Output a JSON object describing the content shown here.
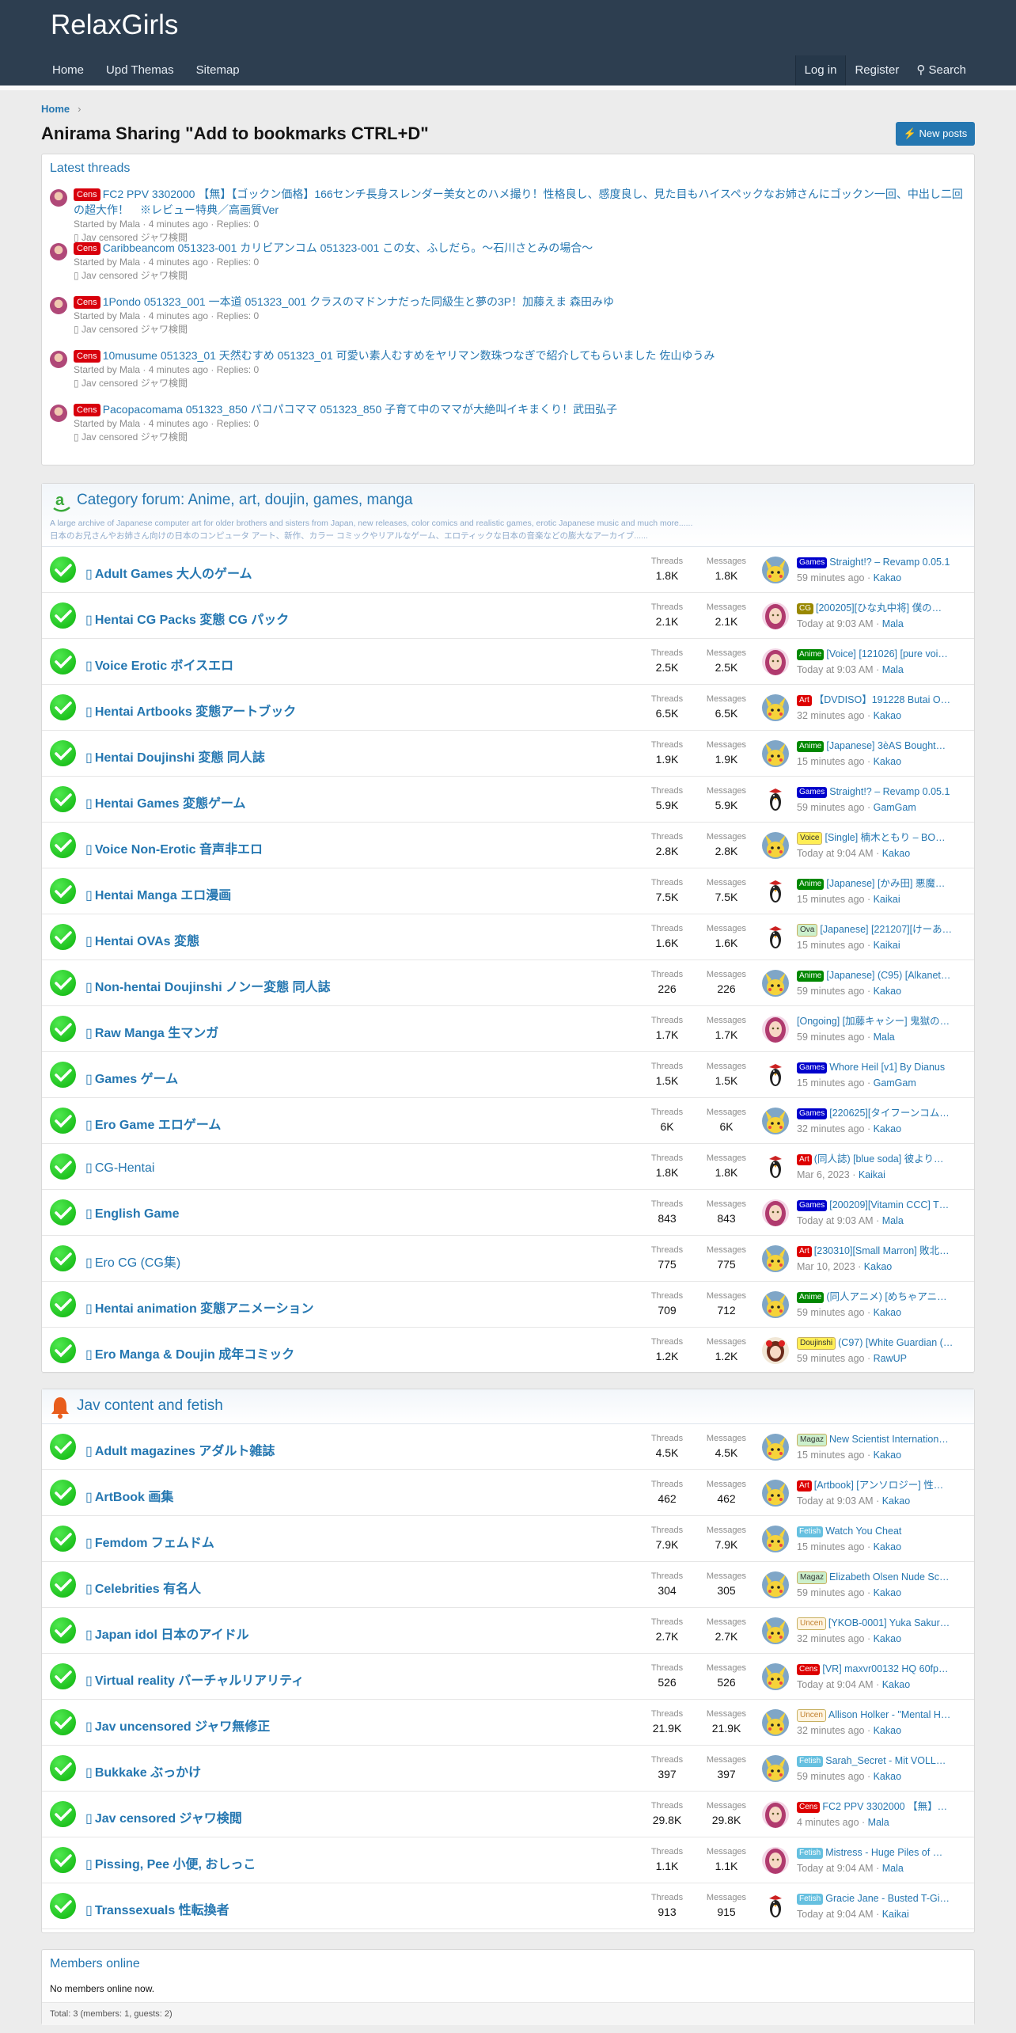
{
  "site": {
    "logo": "RelaxGirls"
  },
  "nav": {
    "left": [
      "Home",
      "Upd Themas",
      "Sitemap"
    ],
    "login": "Log in",
    "register": "Register",
    "search": "Search"
  },
  "breadcrumb": {
    "home": "Home"
  },
  "page": {
    "title": "Anirama Sharing \"Add to bookmarks CTRL+D\"",
    "new_posts": "New posts"
  },
  "latest": {
    "title": "Latest threads",
    "items": [
      {
        "tag": "Cens",
        "title": "FC2 PPV 3302000 【無】【ゴックン価格】166センチ長身スレンダー美女とのハメ撮り！性格良し、感度良し、見た目もハイスペックなお姉さんにゴックン一回、中出し二回の超大作！　※レビュー特典／高画質Ver",
        "meta": "Started by Mala · 4 minutes ago · Replies: 0",
        "forum": "Jav censored ジャワ検閲"
      },
      {
        "tag": "Cens",
        "title": "Caribbeancom 051323-001 カリビアンコム 051323-001 この女、ふしだら。～石川さとみの場合～",
        "meta": "Started by Mala · 4 minutes ago · Replies: 0",
        "forum": "Jav censored ジャワ検閲"
      },
      {
        "tag": "Cens",
        "title": "1Pondo 051323_001 一本道 051323_001 クラスのマドンナだった同級生と夢の3P！加藤えま 森田みゆ",
        "meta": "Started by Mala · 4 minutes ago · Replies: 0",
        "forum": "Jav censored ジャワ検閲"
      },
      {
        "tag": "Cens",
        "title": "10musume 051323_01 天然むすめ 051323_01 可愛い素人むすめをヤリマン数珠つなぎで紹介してもらいました 佐山ゆうみ",
        "meta": "Started by Mala · 4 minutes ago · Replies: 0",
        "forum": "Jav censored ジャワ検閲"
      },
      {
        "tag": "Cens",
        "title": "Pacopacomama 051323_850 パコパコママ 051323_850 子育て中のママが大絶叫イキまくり！武田弘子",
        "meta": "Started by Mala · 4 minutes ago · Replies: 0",
        "forum": "Jav censored ジャワ検閲"
      }
    ]
  },
  "stat_labels": {
    "threads": "Threads",
    "messages": "Messages"
  },
  "cat1": {
    "title": "Category forum: Anime, art, doujin, games, manga",
    "desc1": "A large archive of Japanese computer art for older brothers and sisters from Japan, new releases, color comics and realistic games, erotic Japanese music and much more......",
    "desc2": "日本のお兄さんやお姉さん向けの日本のコンピュータ アート、新作、カラー コミックやリアルなゲーム、エロティックな日本の音楽などの膨大なアーカイブ......",
    "forums": [
      {
        "name": "Adult Games 大人のゲーム",
        "bold": true,
        "threads": "1.8K",
        "messages": "1.8K",
        "av": "pika",
        "tag": "Games",
        "tagc": "#0000cc",
        "tagf": "#fff",
        "last": "Straight!? – Revamp 0.05.1",
        "time": "59 minutes ago",
        "user": "Kakao"
      },
      {
        "name": "Hentai CG Packs 変態 CG パック",
        "bold": true,
        "threads": "2.1K",
        "messages": "2.1K",
        "av": "girl",
        "tag": "CG",
        "tagc": "#998800",
        "tagf": "#fff",
        "last": "[200205][ひな丸中将] 僕の…",
        "time": "Today at 9:03 AM",
        "user": "Mala"
      },
      {
        "name": "Voice Erotic ボイスエロ",
        "bold": true,
        "threads": "2.5K",
        "messages": "2.5K",
        "av": "girl",
        "tag": "Anime",
        "tagc": "#008800",
        "tagf": "#fff",
        "last": "[Voice] [121026] [pure voi…",
        "time": "Today at 9:03 AM",
        "user": "Mala"
      },
      {
        "name": "Hentai Artbooks 変態アートブック",
        "bold": true,
        "threads": "6.5K",
        "messages": "6.5K",
        "av": "pika",
        "tag": "Art",
        "tagc": "#dd0000",
        "tagf": "#fff",
        "last": "【DVDISO】191228 Butai O…",
        "time": "32 minutes ago",
        "user": "Kakao"
      },
      {
        "name": "Hentai Doujinshi 変態 同人誌",
        "bold": true,
        "threads": "1.9K",
        "messages": "1.9K",
        "av": "pika",
        "tag": "Anime",
        "tagc": "#008800",
        "tagf": "#fff",
        "last": "[Japanese] 3èAS Bought…",
        "time": "15 minutes ago",
        "user": "Kakao"
      },
      {
        "name": "Hentai Games 変態ゲーム",
        "bold": true,
        "threads": "5.9K",
        "messages": "5.9K",
        "av": "pen",
        "tag": "Games",
        "tagc": "#0000cc",
        "tagf": "#fff",
        "last": "Straight!? – Revamp 0.05.1",
        "time": "59 minutes ago",
        "user": "GamGam"
      },
      {
        "name": "Voice Non-Erotic 音声非エロ",
        "bold": true,
        "threads": "2.8K",
        "messages": "2.8K",
        "av": "pika",
        "tag": "Voice",
        "tagc": "#ffee55",
        "tagf": "#333",
        "last": "[Single] 楠木ともり – BO…",
        "time": "Today at 9:04 AM",
        "user": "Kakao"
      },
      {
        "name": "Hentai Manga エロ漫画",
        "bold": true,
        "threads": "7.5K",
        "messages": "7.5K",
        "av": "pen",
        "tag": "Anime",
        "tagc": "#008800",
        "tagf": "#fff",
        "last": "[Japanese] [かみ田] 悪魔…",
        "time": "15 minutes ago",
        "user": "Kaikai"
      },
      {
        "name": "Hentai OVAs 変態",
        "bold": true,
        "threads": "1.6K",
        "messages": "1.6K",
        "av": "pen",
        "tag": "Ova",
        "tagc": "#ccf0cc",
        "tagf": "#333",
        "last": "[Japanese] [221207][けーあ…",
        "time": "15 minutes ago",
        "user": "Kaikai"
      },
      {
        "name": "Non-hentai Doujinshi ノンー変態 同人誌",
        "bold": true,
        "threads": "226",
        "messages": "226",
        "av": "pika",
        "tag": "Anime",
        "tagc": "#008800",
        "tagf": "#fff",
        "last": "[Japanese] (C95) [Alkanet…",
        "time": "59 minutes ago",
        "user": "Kakao"
      },
      {
        "name": "Raw Manga 生マンガ",
        "bold": true,
        "threads": "1.7K",
        "messages": "1.7K",
        "av": "girl",
        "tag": "",
        "tagc": "",
        "tagf": "",
        "last": "[Ongoing] [加藤キャシー] 鬼獄の…",
        "time": "59 minutes ago",
        "user": "Mala"
      },
      {
        "name": "Games ゲーム",
        "bold": true,
        "threads": "1.5K",
        "messages": "1.5K",
        "av": "pen",
        "tag": "Games",
        "tagc": "#0000cc",
        "tagf": "#fff",
        "last": "Whore Heil [v1] By Dianus",
        "time": "15 minutes ago",
        "user": "GamGam"
      },
      {
        "name": "Ero Game エロゲーム",
        "bold": true,
        "threads": "6K",
        "messages": "6K",
        "av": "pika",
        "tag": "Games",
        "tagc": "#0000cc",
        "tagf": "#fff",
        "last": "[220625][タイフーンコム…",
        "time": "32 minutes ago",
        "user": "Kakao"
      },
      {
        "name": "CG-Hentai",
        "bold": false,
        "threads": "1.8K",
        "messages": "1.8K",
        "av": "pen",
        "tag": "Art",
        "tagc": "#dd0000",
        "tagf": "#fff",
        "last": "(同人誌) [blue soda] 彼より…",
        "time": "Mar 6, 2023",
        "user": "Kaikai"
      },
      {
        "name": "English Game",
        "bold": true,
        "threads": "843",
        "messages": "843",
        "av": "girl",
        "tag": "Games",
        "tagc": "#0000cc",
        "tagf": "#fff",
        "last": "[200209][Vitamin CCC] T…",
        "time": "Today at 9:03 AM",
        "user": "Mala"
      },
      {
        "name": "Ero CG (CG集)",
        "bold": false,
        "threads": "775",
        "messages": "775",
        "av": "pika",
        "tag": "Art",
        "tagc": "#dd0000",
        "tagf": "#fff",
        "last": "[230310][Small Marron] 敗北…",
        "time": "Mar 10, 2023",
        "user": "Kakao"
      },
      {
        "name": "Hentai animation 変態アニメーション",
        "bold": true,
        "threads": "709",
        "messages": "712",
        "av": "pika",
        "tag": "Anime",
        "tagc": "#008800",
        "tagf": "#fff",
        "last": "(同人アニメ) [めちゃアニ…",
        "time": "59 minutes ago",
        "user": "Kakao"
      },
      {
        "name": "Ero Manga & Doujin 成年コミック",
        "bold": true,
        "threads": "1.2K",
        "messages": "1.2K",
        "av": "cherry",
        "tag": "Doujinshi",
        "tagc": "#ffee55",
        "tagf": "#333",
        "last": "(C97) [White Guardian (…",
        "time": "59 minutes ago",
        "user": "RawUP"
      }
    ]
  },
  "cat2": {
    "title": "Jav content and fetish",
    "forums": [
      {
        "name": "Adult magazines アダルト雑誌",
        "bold": true,
        "threads": "4.5K",
        "messages": "4.5K",
        "av": "pika",
        "tag": "Magaz",
        "tagc": "#ccf0cc",
        "tagf": "#333",
        "last": "New Scientist Internation…",
        "time": "15 minutes ago",
        "user": "Kakao"
      },
      {
        "name": "ArtBook 画集",
        "bold": true,
        "threads": "462",
        "messages": "462",
        "av": "pika",
        "tag": "Art",
        "tagc": "#dd0000",
        "tagf": "#fff",
        "last": "[Artbook] [アンソロジー] 性…",
        "time": "Today at 9:03 AM",
        "user": "Kakao"
      },
      {
        "name": "Femdom フェムドム",
        "bold": true,
        "threads": "7.9K",
        "messages": "7.9K",
        "av": "pika",
        "tag": "Fetish",
        "tagc": "#66c0e0",
        "tagf": "#fff",
        "last": "Watch You Cheat",
        "time": "15 minutes ago",
        "user": "Kakao"
      },
      {
        "name": "Celebrities 有名人",
        "bold": true,
        "threads": "304",
        "messages": "305",
        "av": "pika",
        "tag": "Magaz",
        "tagc": "#ccf0cc",
        "tagf": "#333",
        "last": "Elizabeth Olsen Nude Sc…",
        "time": "59 minutes ago",
        "user": "Kakao"
      },
      {
        "name": "Japan idol 日本のアイドル",
        "bold": true,
        "threads": "2.7K",
        "messages": "2.7K",
        "av": "pika",
        "tag": "Uncen",
        "tagc": "#fff4e0",
        "tagf": "#c08030",
        "last": "[YKOB-0001] Yuka Sakur…",
        "time": "32 minutes ago",
        "user": "Kakao"
      },
      {
        "name": "Virtual reality バーチャルリアリティ",
        "bold": true,
        "threads": "526",
        "messages": "526",
        "av": "pika",
        "tag": "Cens",
        "tagc": "#dd0000",
        "tagf": "#fff",
        "last": "[VR] maxvr00132 HQ 60fp…",
        "time": "Today at 9:04 AM",
        "user": "Kakao"
      },
      {
        "name": "Jav uncensored ジャワ無修正",
        "bold": true,
        "threads": "21.9K",
        "messages": "21.9K",
        "av": "pika",
        "tag": "Uncen",
        "tagc": "#fff4e0",
        "tagf": "#c08030",
        "last": "Allison Holker - \"Mental H…",
        "time": "32 minutes ago",
        "user": "Kakao"
      },
      {
        "name": "Bukkake ぶっかけ",
        "bold": true,
        "threads": "397",
        "messages": "397",
        "av": "pika",
        "tag": "Fetish",
        "tagc": "#66c0e0",
        "tagf": "#fff",
        "last": "Sarah_Secret - Mit VOLL…",
        "time": "59 minutes ago",
        "user": "Kakao"
      },
      {
        "name": "Jav censored ジャワ検閲",
        "bold": true,
        "threads": "29.8K",
        "messages": "29.8K",
        "av": "girl",
        "tag": "Cens",
        "tagc": "#dd0000",
        "tagf": "#fff",
        "last": "FC2 PPV 3302000 【無】…",
        "time": "4 minutes ago",
        "user": "Mala"
      },
      {
        "name": "Pissing, Pee 小便, おしっこ",
        "bold": true,
        "threads": "1.1K",
        "messages": "1.1K",
        "av": "girl",
        "tag": "Fetish",
        "tagc": "#66c0e0",
        "tagf": "#fff",
        "last": "Mistress - Huge Piles of …",
        "time": "Today at 9:04 AM",
        "user": "Mala"
      },
      {
        "name": "Transsexuals 性転換者",
        "bold": true,
        "threads": "913",
        "messages": "915",
        "av": "pen",
        "tag": "Fetish",
        "tagc": "#66c0e0",
        "tagf": "#fff",
        "last": "Gracie Jane - Busted T-Gi…",
        "time": "Today at 9:04 AM",
        "user": "Kaikai"
      }
    ]
  },
  "members": {
    "title": "Members online",
    "none": "No members online now.",
    "total": "Total: 3 (members: 1, guests: 2)"
  }
}
